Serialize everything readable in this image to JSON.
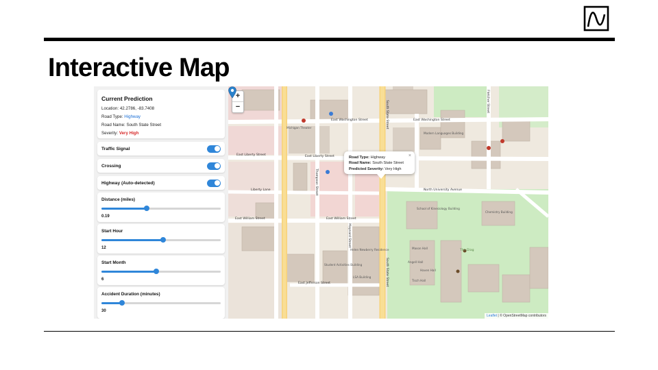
{
  "slide": {
    "title": "Interactive Map"
  },
  "prediction": {
    "title": "Current Prediction",
    "location_label": "Location:",
    "location_value": "42.2786, -83.7408",
    "road_type_label": "Road Type:",
    "road_type_value": "Highway",
    "road_name_label": "Road Name:",
    "road_name_value": "South State Street",
    "severity_label": "Severity:",
    "severity_value": "Very High"
  },
  "toggles": [
    {
      "label": "Traffic Signal",
      "on": true
    },
    {
      "label": "Crossing",
      "on": true
    },
    {
      "label": "Highway (Auto-detected)",
      "on": true
    }
  ],
  "sliders": [
    {
      "label": "Distance (miles)",
      "value": "0.19",
      "fraction": 0.38
    },
    {
      "label": "Start Hour",
      "value": "12",
      "fraction": 0.52
    },
    {
      "label": "Start Month",
      "value": "6",
      "fraction": 0.46
    },
    {
      "label": "Accident Duration (minutes)",
      "value": "30",
      "fraction": 0.17
    }
  ],
  "map": {
    "zoom_in": "+",
    "zoom_out": "−",
    "popup": {
      "road_type_label": "Road Type:",
      "road_type_value": "Highway",
      "road_name_label": "Road Name:",
      "road_name_value": "South State Street",
      "severity_label": "Predicted Severity:",
      "severity_value": "Very High",
      "close": "×"
    },
    "streets": {
      "east_washington": "East Washington Street",
      "east_liberty": "East Liberty Street",
      "liberty_lane": "Liberty Lane",
      "east_william": "East William Street",
      "north_university": "North University Avenue",
      "east_jefferson": "East Jefferson Street",
      "south_state": "South State Street",
      "thompson": "Thompson Street",
      "maynard": "Maynard Street",
      "fletcher": "Fletcher Street"
    },
    "buildings": {
      "michigan_theater": "Michigan Theater",
      "modern_languages": "Modern Languages Building",
      "chemistry": "Chemistry Building",
      "the_diag": "The Diag",
      "mason_hall": "Mason Hall",
      "angell_hall": "Angell Hall",
      "haven_hall": "Haven Hall",
      "kinesiology": "School of Kinesiology Building",
      "helen_newberry": "Helen Newberry Residence",
      "tisch_hall": "Tisch Hall",
      "student_activities": "Student Activities Building",
      "lsa": "LSA Building"
    },
    "attribution_leaflet": "Leaflet",
    "attribution_osm": "| © OpenStreetMap contributors"
  },
  "colors": {
    "accent": "#2f86d9",
    "severity": "#d62828",
    "road_type": "#1a6fd6"
  }
}
